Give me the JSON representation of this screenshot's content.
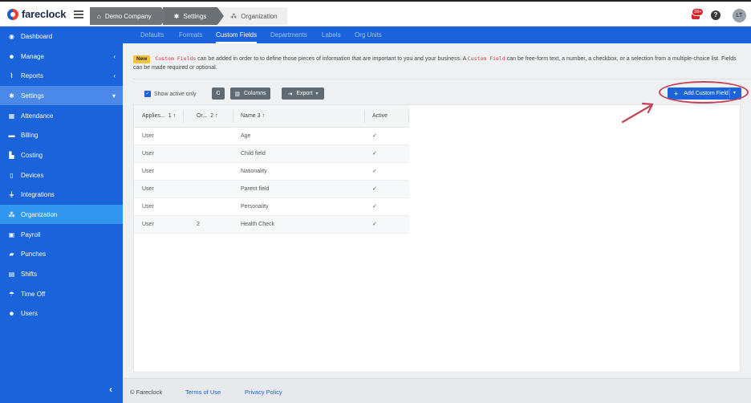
{
  "app": {
    "name": "fareclock"
  },
  "breadcrumbs": [
    {
      "label": "Demo Company",
      "icon": "home-icon"
    },
    {
      "label": "Settings",
      "icon": "gear-icon"
    },
    {
      "label": "Organization",
      "icon": "org-icon"
    }
  ],
  "header": {
    "notification_count": "28+",
    "help_label": "?",
    "avatar_initials": "LT"
  },
  "sidebar": {
    "items": [
      {
        "label": "Dashboard",
        "icon": "dashboard-icon"
      },
      {
        "label": "Manage",
        "icon": "user-icon",
        "chevron": "‹"
      },
      {
        "label": "Reports",
        "icon": "chart-icon",
        "chevron": "‹"
      },
      {
        "label": "Settings",
        "icon": "gear-icon",
        "chevron": "▾"
      },
      {
        "label": "Attendance",
        "icon": "attendance-icon"
      },
      {
        "label": "Billing",
        "icon": "card-icon"
      },
      {
        "label": "Costing",
        "icon": "costing-icon"
      },
      {
        "label": "Devices",
        "icon": "tablet-icon"
      },
      {
        "label": "Integrations",
        "icon": "plug-icon"
      },
      {
        "label": "Organization",
        "icon": "org-icon"
      },
      {
        "label": "Payroll",
        "icon": "money-icon"
      },
      {
        "label": "Punches",
        "icon": "truck-icon"
      },
      {
        "label": "Shifts",
        "icon": "calendar-icon"
      },
      {
        "label": "Time Off",
        "icon": "umbrella-icon"
      },
      {
        "label": "Users",
        "icon": "users-icon"
      }
    ],
    "collapse_label": "‹"
  },
  "subnav": [
    "Defaults",
    "Formats",
    "Custom Fields",
    "Departments",
    "Labels",
    "Org Units"
  ],
  "info": {
    "badge": "New",
    "code1": "Custom Fields",
    "text1": " can be added in order to to define those pieces of information that are important to you and your business. A ",
    "code2": "Custom Field",
    "text2": " can be free-form text, a number, a checkbox, or a selection from a multiple-choice list. Fields can be made required or optional."
  },
  "toolbar": {
    "show_active_label": "Show active only",
    "refresh_label": "C",
    "columns_label": "Columns",
    "export_label": "Export",
    "add_label": "Add Custom Field"
  },
  "table": {
    "headers": [
      {
        "label": "Applies...",
        "sort": "1 ↑"
      },
      {
        "label": "Or...",
        "sort": "2 ↑"
      },
      {
        "label": "Name",
        "sort": "3 ↑"
      },
      {
        "label": "Active",
        "sort": ""
      }
    ],
    "rows": [
      {
        "applies": "User",
        "order": "",
        "name": "Age",
        "active": "✓"
      },
      {
        "applies": "User",
        "order": "",
        "name": "Child field",
        "active": "✓"
      },
      {
        "applies": "User",
        "order": "",
        "name": "Nationality",
        "active": "✓"
      },
      {
        "applies": "User",
        "order": "",
        "name": "Parent field",
        "active": "✓"
      },
      {
        "applies": "User",
        "order": "",
        "name": "Personality",
        "active": "✓"
      },
      {
        "applies": "User",
        "order": "2",
        "name": "Health Check",
        "active": "✓"
      }
    ]
  },
  "footer": {
    "copyright": "© Fareclock",
    "terms": "Terms of Use",
    "privacy": "Privacy Policy"
  },
  "colors": {
    "primary": "#1a63db",
    "active_item": "#3196f0",
    "annotation": "#c24458"
  }
}
